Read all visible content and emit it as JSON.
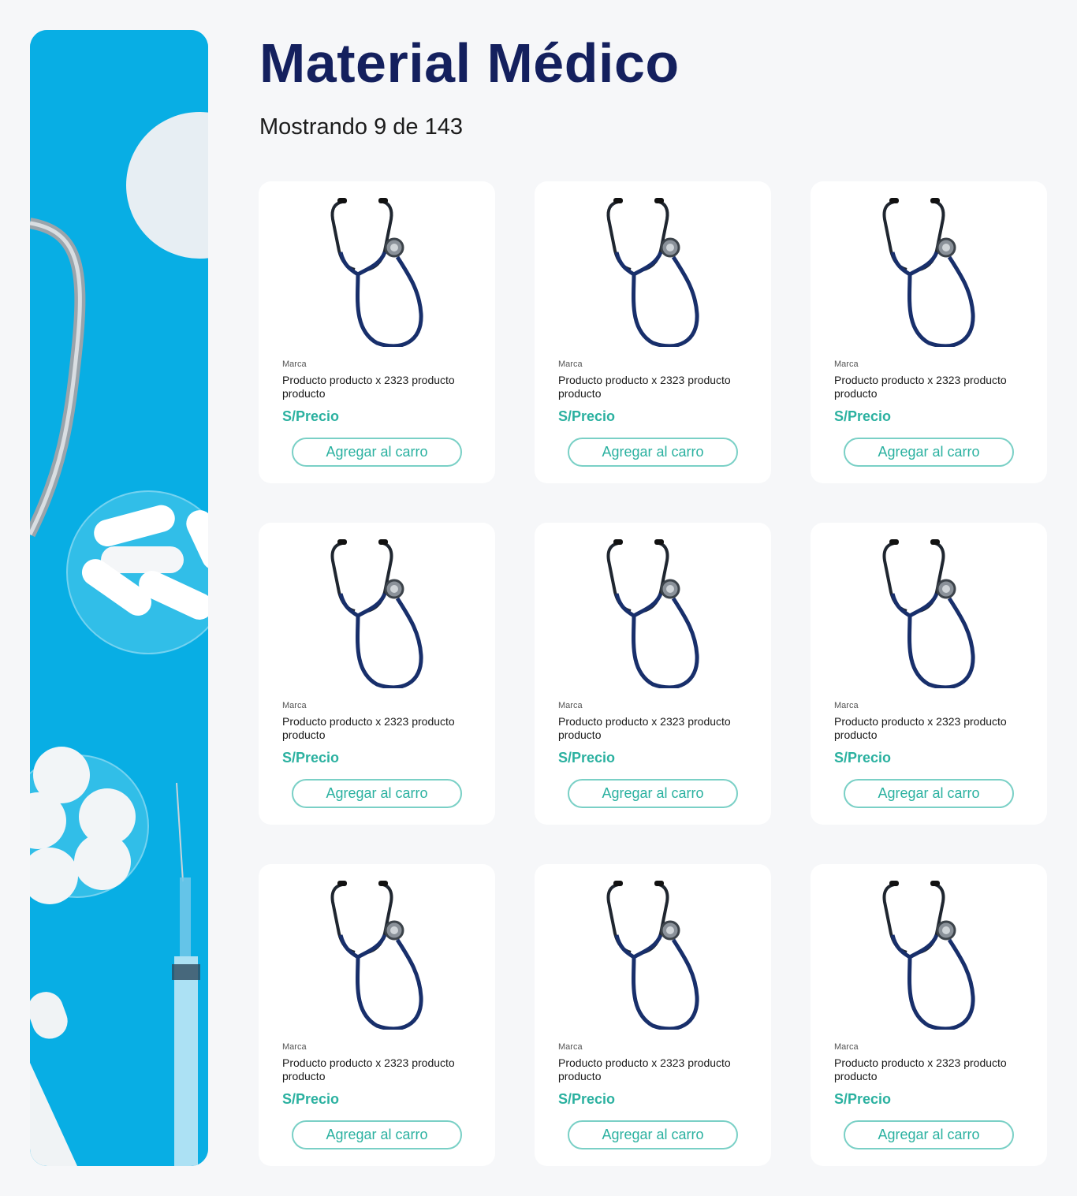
{
  "page": {
    "title": "Material Médico",
    "subtitle": "Mostrando 9 de 143"
  },
  "colors": {
    "background": "#f6f7f9",
    "title": "#14205e",
    "accent": "#2bb1a0",
    "banner": "#08aee4"
  },
  "banner": {
    "icon": "medical-supplies-image"
  },
  "products": [
    {
      "brand": "Marca",
      "name": "Producto producto x 2323 producto producto",
      "price": "S/Precio",
      "button": "Agregar al carro",
      "icon": "stethoscope-icon"
    },
    {
      "brand": "Marca",
      "name": "Producto producto x 2323 producto producto",
      "price": "S/Precio",
      "button": "Agregar al carro",
      "icon": "stethoscope-icon"
    },
    {
      "brand": "Marca",
      "name": "Producto producto x 2323 producto producto",
      "price": "S/Precio",
      "button": "Agregar al carro",
      "icon": "stethoscope-icon"
    },
    {
      "brand": "Marca",
      "name": "Producto producto x 2323 producto producto",
      "price": "S/Precio",
      "button": "Agregar al carro",
      "icon": "stethoscope-icon"
    },
    {
      "brand": "Marca",
      "name": "Producto producto x 2323 producto producto",
      "price": "S/Precio",
      "button": "Agregar al carro",
      "icon": "stethoscope-icon"
    },
    {
      "brand": "Marca",
      "name": "Producto producto x 2323 producto producto",
      "price": "S/Precio",
      "button": "Agregar al carro",
      "icon": "stethoscope-icon"
    },
    {
      "brand": "Marca",
      "name": "Producto producto x 2323 producto producto",
      "price": "S/Precio",
      "button": "Agregar al carro",
      "icon": "stethoscope-icon"
    },
    {
      "brand": "Marca",
      "name": "Producto producto x 2323 producto producto",
      "price": "S/Precio",
      "button": "Agregar al carro",
      "icon": "stethoscope-icon"
    },
    {
      "brand": "Marca",
      "name": "Producto producto x 2323 producto producto",
      "price": "S/Precio",
      "button": "Agregar al carro",
      "icon": "stethoscope-icon"
    }
  ]
}
